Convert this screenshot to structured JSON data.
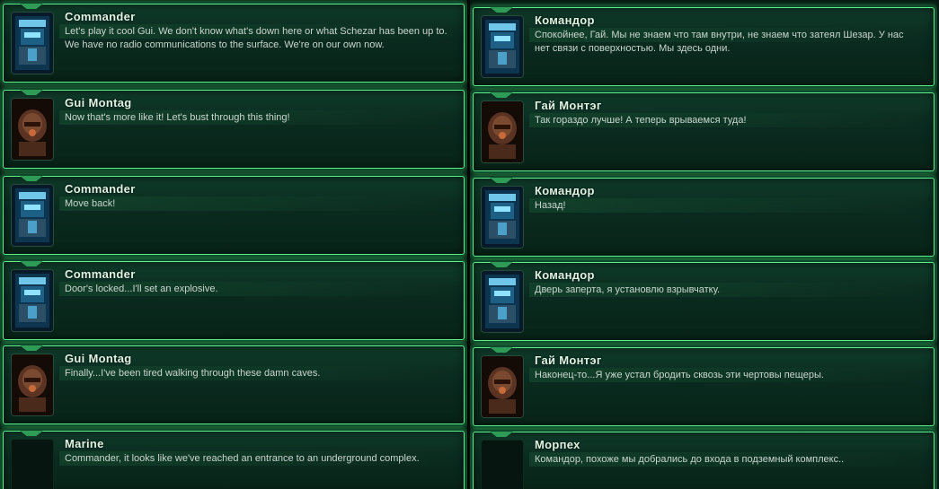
{
  "left": {
    "entries": [
      {
        "speaker": "Commander",
        "text": "Let's play it cool Gui.  We don't know what's down here or what Schezar has been up to.  We have no radio communications to the surface.  We're on our own now.",
        "portrait": "commander-portrait-icon"
      },
      {
        "speaker": "Gui Montag",
        "text": "Now that's more like it!  Let's bust through this thing!",
        "portrait": "gui-montag-portrait-icon"
      },
      {
        "speaker": "Commander",
        "text": "Move back!",
        "portrait": "commander-portrait-icon"
      },
      {
        "speaker": "Commander",
        "text": "Door's locked...I'll set an explosive.",
        "portrait": "commander-portrait-icon"
      },
      {
        "speaker": "Gui Montag",
        "text": "Finally...I've been tired walking through these damn caves.",
        "portrait": "gui-montag-portrait-icon"
      },
      {
        "speaker": "Marine",
        "text": "Commander, it looks like we've reached an entrance to an underground complex.",
        "portrait": "marine-portrait-icon"
      }
    ]
  },
  "right": {
    "entries": [
      {
        "speaker": "Командор",
        "text": "Спокойнее, Гай. Мы не знаем что там внутри, не знаем что затеял Шезар. У нас нет связи с поверхностью. Мы здесь одни.",
        "portrait": "commander-portrait-icon"
      },
      {
        "speaker": "Гай Монтэг",
        "text": "Так гораздо лучше! А теперь врываемся туда!",
        "portrait": "gui-montag-portrait-icon"
      },
      {
        "speaker": "Командор",
        "text": "Назад!",
        "portrait": "commander-portrait-icon"
      },
      {
        "speaker": "Командор",
        "text": "Дверь заперта, я установлю взрывчатку.",
        "portrait": "commander-portrait-icon"
      },
      {
        "speaker": "Гай Монтэг",
        "text": "Наконец-то...Я уже устал бродить сквозь эти чертовы пещеры.",
        "portrait": "gui-montag-portrait-icon"
      },
      {
        "speaker": "Морпех",
        "text": "Командор, похоже мы добрались до входа в подземный комплекс..",
        "portrait": "marine-portrait-icon"
      }
    ]
  },
  "colors": {
    "panel_border": "#5cf08e",
    "panel_glow": "#46e678",
    "panel_bg": "#0a2a1f",
    "name_text": "#dff3e4",
    "body_text": "#c9d6cf"
  }
}
